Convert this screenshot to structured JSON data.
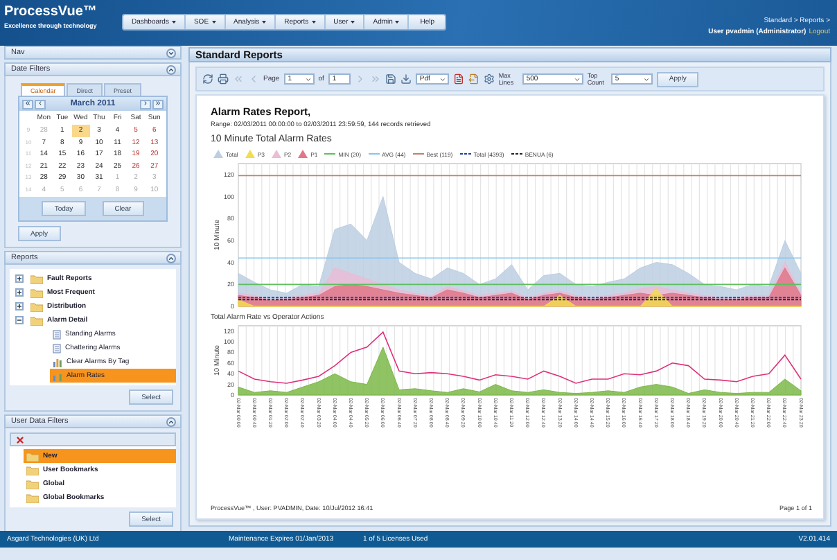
{
  "header": {
    "logo": "ProcessVue™",
    "tagline": "Excellence through technology",
    "menu": [
      {
        "label": "Dashboards",
        "dropdown": true
      },
      {
        "label": "SOE",
        "dropdown": true
      },
      {
        "label": "Analysis",
        "dropdown": true
      },
      {
        "label": "Reports",
        "dropdown": true
      },
      {
        "label": "User",
        "dropdown": true
      },
      {
        "label": "Admin",
        "dropdown": true
      },
      {
        "label": "Help",
        "dropdown": false
      }
    ],
    "breadcrumb": "Standard > Reports >",
    "user": "User pvadmin (Administrator)",
    "logout": "Logout"
  },
  "nav_panel": {
    "title": "Nav",
    "expanded": false
  },
  "date_filters": {
    "title": "Date Filters",
    "expanded": true,
    "tabs": [
      {
        "label": "Calendar",
        "selected": true
      },
      {
        "label": "Direct",
        "selected": false
      },
      {
        "label": "Preset",
        "selected": false
      }
    ],
    "calendar": {
      "month": "March 2011",
      "first": "«",
      "prev": "‹",
      "next": "›",
      "last": "»",
      "weekdays": [
        "Mon",
        "Tue",
        "Wed",
        "Thu",
        "Fri",
        "Sat",
        "Sun"
      ],
      "weeks": [
        {
          "week": "9",
          "days": [
            {
              "d": "28",
              "other": true,
              "selected": false
            },
            {
              "d": "1",
              "other": false,
              "selected": false
            },
            {
              "d": "2",
              "other": false,
              "selected": true
            },
            {
              "d": "3",
              "other": false,
              "selected": false
            },
            {
              "d": "4",
              "other": false,
              "selected": false
            },
            {
              "d": "5",
              "other": false,
              "selected": false
            },
            {
              "d": "6",
              "other": false,
              "selected": false
            }
          ]
        },
        {
          "week": "10",
          "days": [
            {
              "d": "7",
              "other": false,
              "selected": false
            },
            {
              "d": "8",
              "other": false,
              "selected": false
            },
            {
              "d": "9",
              "other": false,
              "selected": false
            },
            {
              "d": "10",
              "other": false,
              "selected": false
            },
            {
              "d": "11",
              "other": false,
              "selected": false
            },
            {
              "d": "12",
              "other": false,
              "selected": false
            },
            {
              "d": "13",
              "other": false,
              "selected": false
            }
          ]
        },
        {
          "week": "11",
          "days": [
            {
              "d": "14",
              "other": false,
              "selected": false
            },
            {
              "d": "15",
              "other": false,
              "selected": false
            },
            {
              "d": "16",
              "other": false,
              "selected": false
            },
            {
              "d": "17",
              "other": false,
              "selected": false
            },
            {
              "d": "18",
              "other": false,
              "selected": false
            },
            {
              "d": "19",
              "other": false,
              "selected": false
            },
            {
              "d": "20",
              "other": false,
              "selected": false
            }
          ]
        },
        {
          "week": "12",
          "days": [
            {
              "d": "21",
              "other": false,
              "selected": false
            },
            {
              "d": "22",
              "other": false,
              "selected": false
            },
            {
              "d": "23",
              "other": false,
              "selected": false
            },
            {
              "d": "24",
              "other": false,
              "selected": false
            },
            {
              "d": "25",
              "other": false,
              "selected": false
            },
            {
              "d": "26",
              "other": false,
              "selected": false
            },
            {
              "d": "27",
              "other": false,
              "selected": false
            }
          ]
        },
        {
          "week": "13",
          "days": [
            {
              "d": "28",
              "other": false,
              "selected": false
            },
            {
              "d": "29",
              "other": false,
              "selected": false
            },
            {
              "d": "30",
              "other": false,
              "selected": false
            },
            {
              "d": "31",
              "other": false,
              "selected": false
            },
            {
              "d": "1",
              "other": true,
              "selected": false
            },
            {
              "d": "2",
              "other": true,
              "selected": false
            },
            {
              "d": "3",
              "other": true,
              "selected": false
            }
          ]
        },
        {
          "week": "14",
          "days": [
            {
              "d": "4",
              "other": true,
              "selected": false
            },
            {
              "d": "5",
              "other": true,
              "selected": false
            },
            {
              "d": "6",
              "other": true,
              "selected": false
            },
            {
              "d": "7",
              "other": true,
              "selected": false
            },
            {
              "d": "8",
              "other": true,
              "selected": false
            },
            {
              "d": "9",
              "other": true,
              "selected": false
            },
            {
              "d": "10",
              "other": true,
              "selected": false
            }
          ]
        }
      ]
    },
    "buttons": [
      "Today",
      "Clear"
    ],
    "apply": "Apply"
  },
  "reports": {
    "title": "Reports",
    "expanded": true,
    "select": "Select",
    "tree": [
      {
        "label": "Fault Reports",
        "kind": "folder",
        "expanded": false,
        "selected": false
      },
      {
        "label": "Most Frequent",
        "kind": "folder",
        "expanded": false,
        "selected": false
      },
      {
        "label": "Distribution",
        "kind": "folder",
        "expanded": false,
        "selected": false
      },
      {
        "label": "Alarm Detail",
        "kind": "folder",
        "expanded": true,
        "selected": false,
        "children": [
          {
            "label": "Standing Alarms",
            "kind": "report",
            "selected": false
          },
          {
            "label": "Chattering Alarms",
            "kind": "report",
            "selected": false
          },
          {
            "label": "Clear Alarms By Tag",
            "kind": "chart",
            "selected": false
          },
          {
            "label": "Alarm Rates",
            "kind": "chart",
            "selected": true
          }
        ]
      }
    ]
  },
  "user_filters": {
    "title": "User Data Filters",
    "expanded": true,
    "select": "Select",
    "tree": [
      {
        "label": "New",
        "selected": true
      },
      {
        "label": "User Bookmarks",
        "selected": false
      },
      {
        "label": "Global",
        "selected": false
      },
      {
        "label": "Global Bookmarks",
        "selected": false
      }
    ]
  },
  "main": {
    "title": "Standard Reports",
    "toolbar": {
      "paging_disabled": true,
      "page_label": "Page",
      "page": "1",
      "of_label": "of",
      "page_count": "1",
      "format": "Pdf",
      "max_lines_label": "Max Lines",
      "max_lines": "500",
      "top_count_label": "Top Count",
      "top_count": "5",
      "apply": "Apply"
    },
    "report": {
      "title": "Alarm Rates Report,",
      "range": "Range: 02/03/2011 00:00:00 to 02/03/2011 23:59:59, 144 records retrieved",
      "charts": [
        {
          "chart_data": {
            "type": "area",
            "title": "10 Minute Total Alarm Rates",
            "grid": true,
            "ylabel": "10 Minute",
            "ylim": [
              0,
              130
            ],
            "yticks": [
              0,
              20,
              40,
              60,
              80,
              100,
              120
            ],
            "series": [
              {
                "name": "Total",
                "type": "area",
                "color": "#bccfe2",
                "values": [
                  30,
                  22,
                  15,
                  12,
                  20,
                  18,
                  70,
                  75,
                  60,
                  100,
                  40,
                  30,
                  25,
                  35,
                  30,
                  20,
                  25,
                  38,
                  15,
                  28,
                  30,
                  20,
                  18,
                  22,
                  25,
                  35,
                  40,
                  38,
                  30,
                  20,
                  18,
                  15,
                  20,
                  18,
                  60,
                  30
                ]
              },
              {
                "name": "P3",
                "type": "area",
                "color": "#f2dc50",
                "values": [
                  6,
                  0,
                  0,
                  0,
                  0,
                  0,
                  0,
                  0,
                  0,
                  0,
                  0,
                  0,
                  0,
                  0,
                  0,
                  0,
                  0,
                  0,
                  0,
                  0,
                  10,
                  0,
                  0,
                  0,
                  0,
                  0,
                  16,
                  0,
                  0,
                  0,
                  0,
                  0,
                  0,
                  0,
                  0,
                  0
                ]
              },
              {
                "name": "P2",
                "type": "area",
                "color": "#e9bdd6",
                "values": [
                  12,
                  10,
                  6,
                  8,
                  10,
                  12,
                  35,
                  30,
                  25,
                  20,
                  15,
                  12,
                  10,
                  18,
                  14,
                  10,
                  12,
                  14,
                  8,
                  12,
                  14,
                  10,
                  8,
                  10,
                  12,
                  16,
                  18,
                  15,
                  12,
                  10,
                  8,
                  8,
                  10,
                  10,
                  40,
                  12
                ]
              },
              {
                "name": "P1",
                "type": "area",
                "color": "#e07888",
                "values": [
                  10,
                  8,
                  5,
                  6,
                  8,
                  10,
                  18,
                  20,
                  18,
                  15,
                  12,
                  10,
                  8,
                  15,
                  12,
                  8,
                  10,
                  12,
                  6,
                  10,
                  12,
                  8,
                  6,
                  8,
                  10,
                  12,
                  10,
                  12,
                  10,
                  8,
                  6,
                  6,
                  8,
                  8,
                  35,
                  10
                ]
              },
              {
                "name": "MIN (20)",
                "type": "line",
                "color": "#5cbf5c",
                "values": [
                  20,
                  20,
                  20,
                  20,
                  20,
                  20,
                  20,
                  20,
                  20,
                  20,
                  20,
                  20,
                  20,
                  20,
                  20,
                  20,
                  20,
                  20,
                  20,
                  20,
                  20,
                  20,
                  20,
                  20,
                  20,
                  20,
                  20,
                  20,
                  20,
                  20,
                  20,
                  20,
                  20,
                  20,
                  20,
                  20
                ]
              },
              {
                "name": "AVG (44)",
                "type": "line",
                "color": "#86c4f0",
                "values": [
                  44,
                  44,
                  44,
                  44,
                  44,
                  44,
                  44,
                  44,
                  44,
                  44,
                  44,
                  44,
                  44,
                  44,
                  44,
                  44,
                  44,
                  44,
                  44,
                  44,
                  44,
                  44,
                  44,
                  44,
                  44,
                  44,
                  44,
                  44,
                  44,
                  44,
                  44,
                  44,
                  44,
                  44,
                  44,
                  44
                ]
              },
              {
                "name": "Best (119)",
                "type": "line",
                "color": "#c0806c",
                "values": [
                  119,
                  119,
                  119,
                  119,
                  119,
                  119,
                  119,
                  119,
                  119,
                  119,
                  119,
                  119,
                  119,
                  119,
                  119,
                  119,
                  119,
                  119,
                  119,
                  119,
                  119,
                  119,
                  119,
                  119,
                  119,
                  119,
                  119,
                  119,
                  119,
                  119,
                  119,
                  119,
                  119,
                  119,
                  119,
                  119
                ]
              },
              {
                "name": "Total (4393)",
                "type": "line",
                "line_style": "dashed",
                "color": "#2040a0",
                "values": [
                  8,
                  8,
                  8,
                  8,
                  8,
                  8,
                  8,
                  8,
                  8,
                  8,
                  8,
                  8,
                  8,
                  8,
                  8,
                  8,
                  8,
                  8,
                  8,
                  8,
                  8,
                  8,
                  8,
                  8,
                  8,
                  8,
                  8,
                  8,
                  8,
                  8,
                  8,
                  8,
                  8,
                  8,
                  8,
                  8
                ]
              },
              {
                "name": "BENUA (6)",
                "type": "line",
                "line_style": "dashed",
                "color": "#202020",
                "values": [
                  6,
                  6,
                  6,
                  6,
                  6,
                  6,
                  6,
                  6,
                  6,
                  6,
                  6,
                  6,
                  6,
                  6,
                  6,
                  6,
                  6,
                  6,
                  6,
                  6,
                  6,
                  6,
                  6,
                  6,
                  6,
                  6,
                  6,
                  6,
                  6,
                  6,
                  6,
                  6,
                  6,
                  6,
                  6,
                  6
                ]
              }
            ]
          }
        },
        {
          "chart_data": {
            "type": "area",
            "title": "Total Alarm Rate vs Operator Actions",
            "grid": true,
            "ylabel": "10 Minute",
            "ylim": [
              0,
              130
            ],
            "yticks": [
              0,
              20,
              40,
              60,
              80,
              100,
              120
            ],
            "categories": [
              "02-Mar 00:00",
              "02-Mar 00:40",
              "02-Mar 01:20",
              "02-Mar 02:00",
              "02-Mar 02:40",
              "02-Mar 03:20",
              "02-Mar 04:00",
              "02-Mar 04:40",
              "02-Mar 05:20",
              "02-Mar 06:00",
              "02-Mar 06:40",
              "02-Mar 07:20",
              "02-Mar 08:00",
              "02-Mar 08:40",
              "02-Mar 09:20",
              "02-Mar 10:00",
              "02-Mar 10:40",
              "02-Mar 11:20",
              "02-Mar 12:00",
              "02-Mar 12:40",
              "02-Mar 13:20",
              "02-Mar 14:00",
              "02-Mar 14:40",
              "02-Mar 15:20",
              "02-Mar 16:00",
              "02-Mar 16:40",
              "02-Mar 17:20",
              "02-Mar 18:00",
              "02-Mar 18:40",
              "02-Mar 19:20",
              "02-Mar 20:00",
              "02-Mar 20:40",
              "02-Mar 21:20",
              "02-Mar 22:00",
              "02-Mar 22:40",
              "02-Mar 23:20"
            ],
            "series": [
              {
                "type": "area",
                "color": "#7cb848",
                "values": [
                  15,
                  5,
                  8,
                  5,
                  15,
                  25,
                  40,
                  25,
                  20,
                  90,
                  10,
                  12,
                  8,
                  5,
                  12,
                  6,
                  20,
                  8,
                  5,
                  10,
                  5,
                  3,
                  5,
                  8,
                  5,
                  15,
                  20,
                  15,
                  3,
                  10,
                  5,
                  3,
                  5,
                  5,
                  30,
                  8
                ]
              },
              {
                "type": "line",
                "color": "#e0307a",
                "values": [
                  45,
                  30,
                  25,
                  22,
                  28,
                  35,
                  55,
                  80,
                  90,
                  118,
                  45,
                  40,
                  42,
                  40,
                  35,
                  28,
                  38,
                  35,
                  30,
                  45,
                  35,
                  22,
                  30,
                  30,
                  40,
                  38,
                  45,
                  60,
                  55,
                  30,
                  28,
                  25,
                  35,
                  40,
                  75,
                  30
                ]
              }
            ]
          }
        }
      ],
      "footer": "ProcessVue™ , User: PVADMIN, Date: 10/Jul/2012 16:41",
      "page": "Page 1 of 1"
    }
  },
  "status_bar": {
    "company": "Asgard Technologies (UK) Ltd",
    "maintenance": "Maintenance Expires 01/Jan/2013",
    "licenses": "1 of 5 Licenses Used",
    "version": "V2.01.414"
  }
}
